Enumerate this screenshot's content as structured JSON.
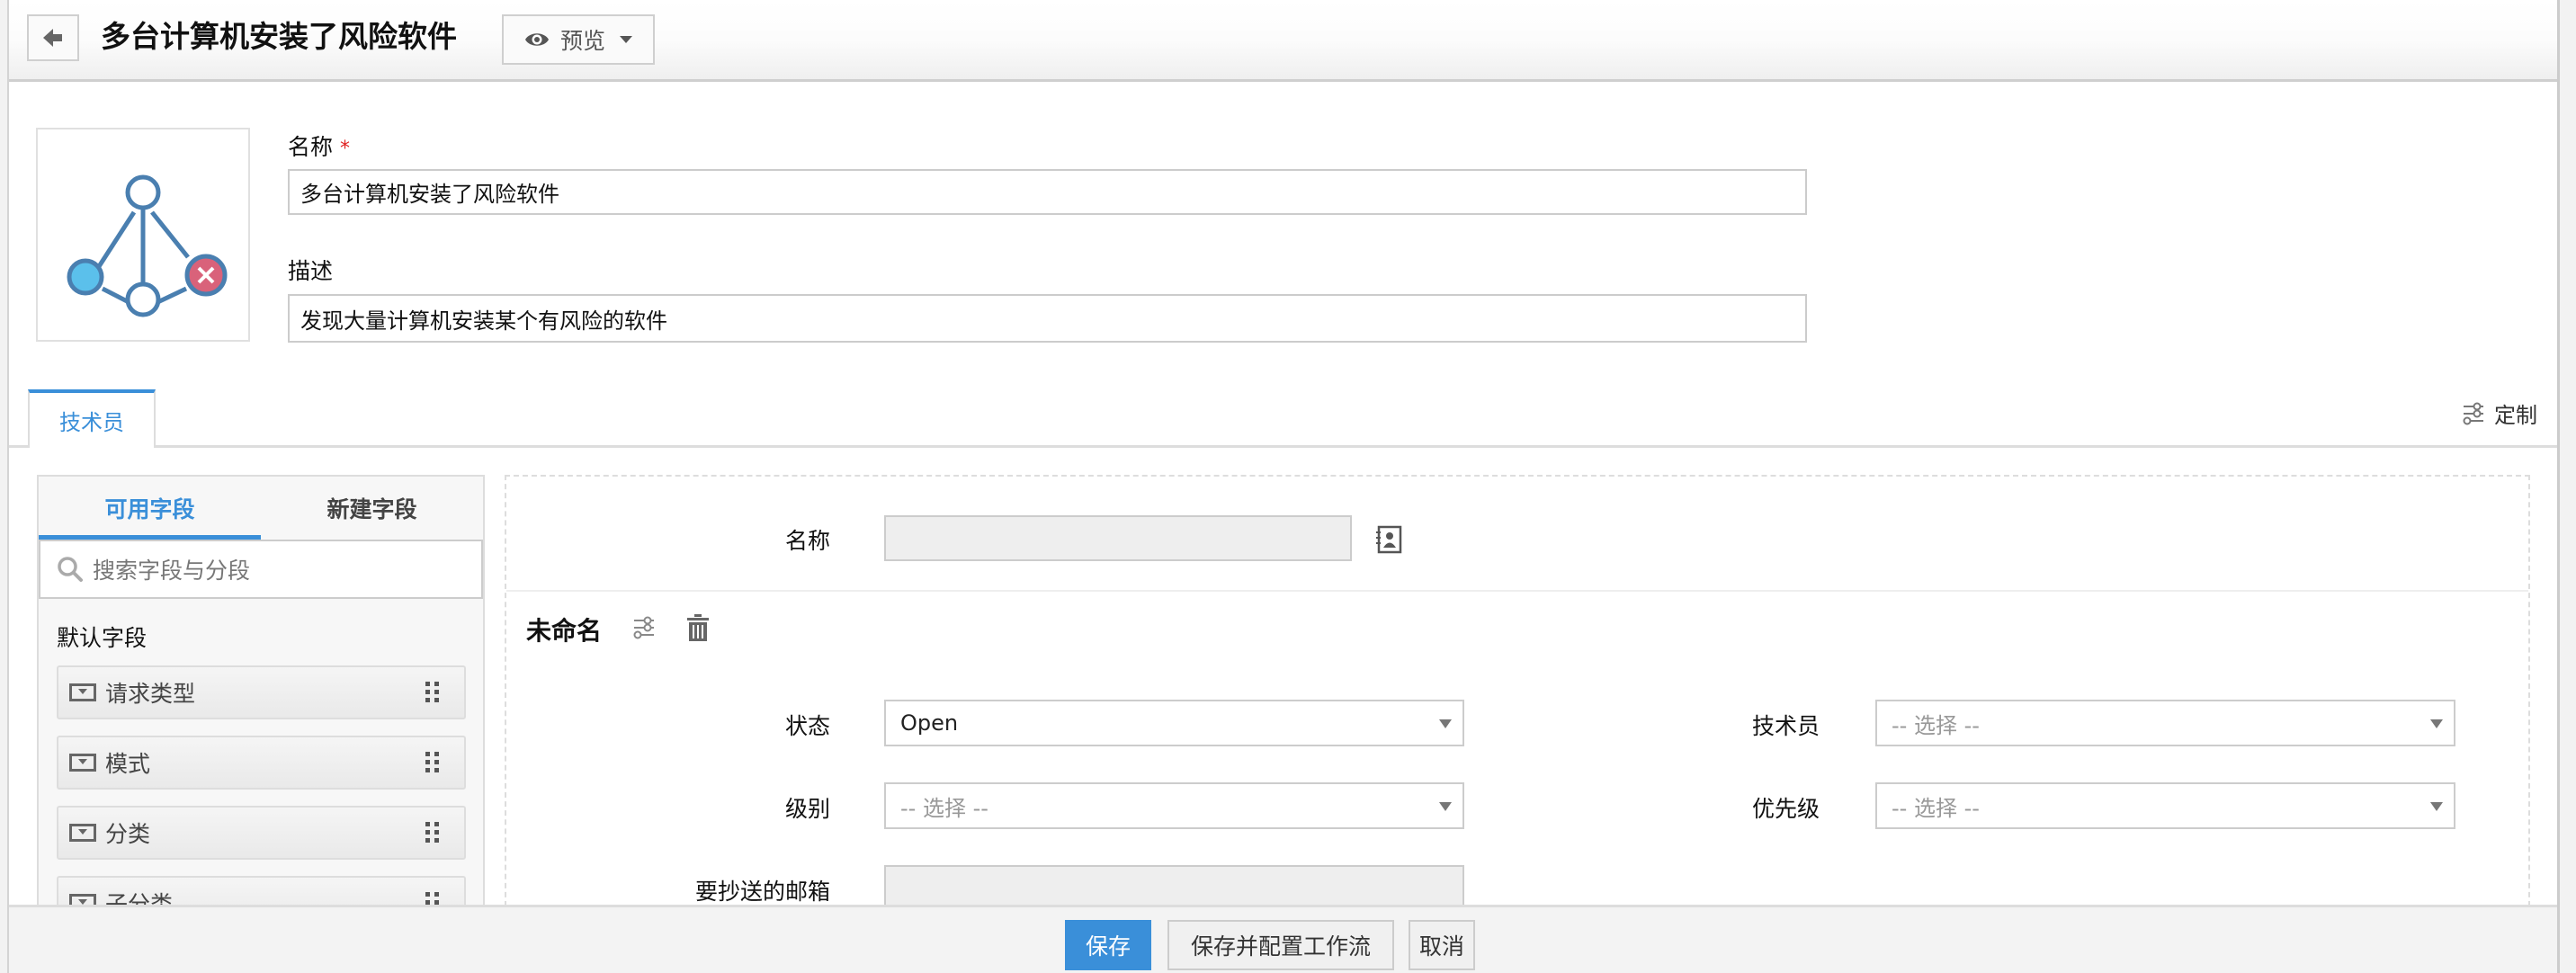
{
  "header": {
    "title": "多台计算机安装了风险软件",
    "preview_label": "预览"
  },
  "info": {
    "name_label": "名称",
    "name_required": "*",
    "name_value": "多台计算机安装了风险软件",
    "description_label": "描述",
    "description_value": "发现大量计算机安装某个有风险的软件"
  },
  "tabs": [
    {
      "label": "技术员",
      "active": true
    }
  ],
  "customize_label": "定制",
  "field_panel": {
    "tabs": [
      {
        "label": "可用字段",
        "active": true
      },
      {
        "label": "新建字段",
        "active": false
      }
    ],
    "search_placeholder": "搜索字段与分段",
    "section_title": "默认字段",
    "items": [
      {
        "label": "请求类型",
        "icon": "dropdown-field-icon"
      },
      {
        "label": "模式",
        "icon": "dropdown-field-icon"
      },
      {
        "label": "分类",
        "icon": "dropdown-field-icon"
      },
      {
        "label": "子分类",
        "icon": "dropdown-field-icon"
      }
    ]
  },
  "form": {
    "name_label": "名称",
    "name_value": "",
    "section_title": "未命名",
    "fields": {
      "status": {
        "label": "状态",
        "value": "Open"
      },
      "technician": {
        "label": "技术员",
        "value": "-- 选择 --"
      },
      "level": {
        "label": "级别",
        "value": "-- 选择 --"
      },
      "priority": {
        "label": "优先级",
        "value": "-- 选择 --"
      },
      "cc_email": {
        "label": "要抄送的邮箱",
        "value": ""
      }
    }
  },
  "footer": {
    "save_label": "保存",
    "save_configure_label": "保存并配置工作流",
    "cancel_label": "取消"
  },
  "colors": {
    "accent": "#3a8fd9",
    "danger_node": "#d9627a",
    "info_node": "#5bc0eb"
  }
}
